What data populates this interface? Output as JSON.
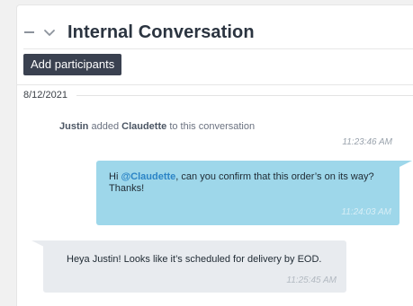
{
  "header": {
    "title": "Internal Conversation",
    "icons": {
      "collapse": "minus-icon",
      "toggle": "chevron-down-icon"
    }
  },
  "actions": {
    "add_participants": "Add participants"
  },
  "conversation": {
    "date": "8/12/2021",
    "system": {
      "actor": "Justin",
      "verb": "added",
      "target": "Claudette",
      "tail": "to this conversation",
      "time": "11:23:46 AM"
    },
    "messages": [
      {
        "direction": "outgoing",
        "prefix": "Hi ",
        "mention": "@Claudette",
        "text": ", can you confirm that this order’s on its way? Thanks!",
        "time": "11:24:03 AM"
      },
      {
        "direction": "incoming",
        "text": "Heya Justin! Looks like it’s scheduled for delivery by EOD.",
        "time": "11:25:45 AM"
      }
    ]
  },
  "colors": {
    "outgoing_bubble": "#9ed7ea",
    "incoming_bubble": "#e8ebef",
    "button_bg": "#3a4150",
    "mention": "#2b84c6"
  }
}
